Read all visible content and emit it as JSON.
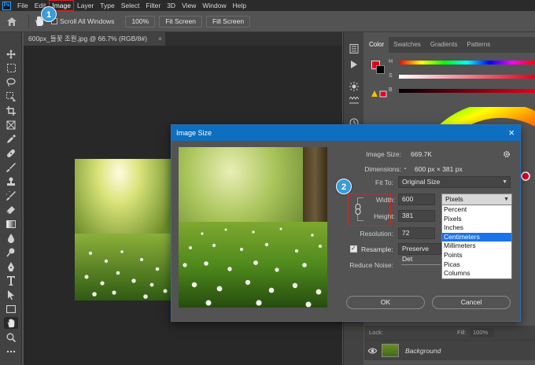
{
  "menubar": {
    "app_logo": "Ps",
    "items": [
      "File",
      "Edit",
      "Image",
      "Layer",
      "Type",
      "Select",
      "Filter",
      "3D",
      "View",
      "Window",
      "Help"
    ]
  },
  "optionsbar": {
    "scroll_all_windows": "Scroll All Windows",
    "zoom_100": "100%",
    "fit_screen_1": "Fit Screen",
    "fit_screen_2": "Fill Screen"
  },
  "steps": {
    "one": "1",
    "two": "2"
  },
  "document": {
    "tab_title": "600px_들꽃 조원.jpg @ 66.7% (RGB/8#)",
    "tab_close": "×"
  },
  "panels": {
    "tabs": [
      "Color",
      "Swatches",
      "Gradients",
      "Patterns"
    ],
    "slider_labels": [
      "H",
      "S",
      "B"
    ],
    "foreground_color": "#e5001c",
    "background_color": "#000000",
    "lock_label": "Lock:",
    "fill_label": "Fill:",
    "fill_value": "100%",
    "layer_name": "Background"
  },
  "dialog": {
    "title": "Image Size",
    "close": "×",
    "image_size_label": "Image Size:",
    "image_size_value": "669.7K",
    "dimensions_label": "Dimensions:",
    "dimensions_value": "600 px × 381 px",
    "fit_to_label": "Fit To:",
    "fit_to_value": "Original Size",
    "width_label": "Width:",
    "width_value": "600",
    "height_label": "Height:",
    "height_value": "381",
    "unit_selected": "Pixels",
    "resolution_label": "Resolution:",
    "resolution_value": "72",
    "resample_label": "Resample:",
    "resample_value": "Preserve Det",
    "reduce_noise_label": "Reduce Noise:",
    "ok_label": "OK",
    "cancel_label": "Cancel"
  },
  "unit_options": [
    "Percent",
    "Pixels",
    "Inches",
    "Centimeters",
    "Millimeters",
    "Points",
    "Picas",
    "Columns"
  ],
  "unit_highlighted": "Centimeters"
}
